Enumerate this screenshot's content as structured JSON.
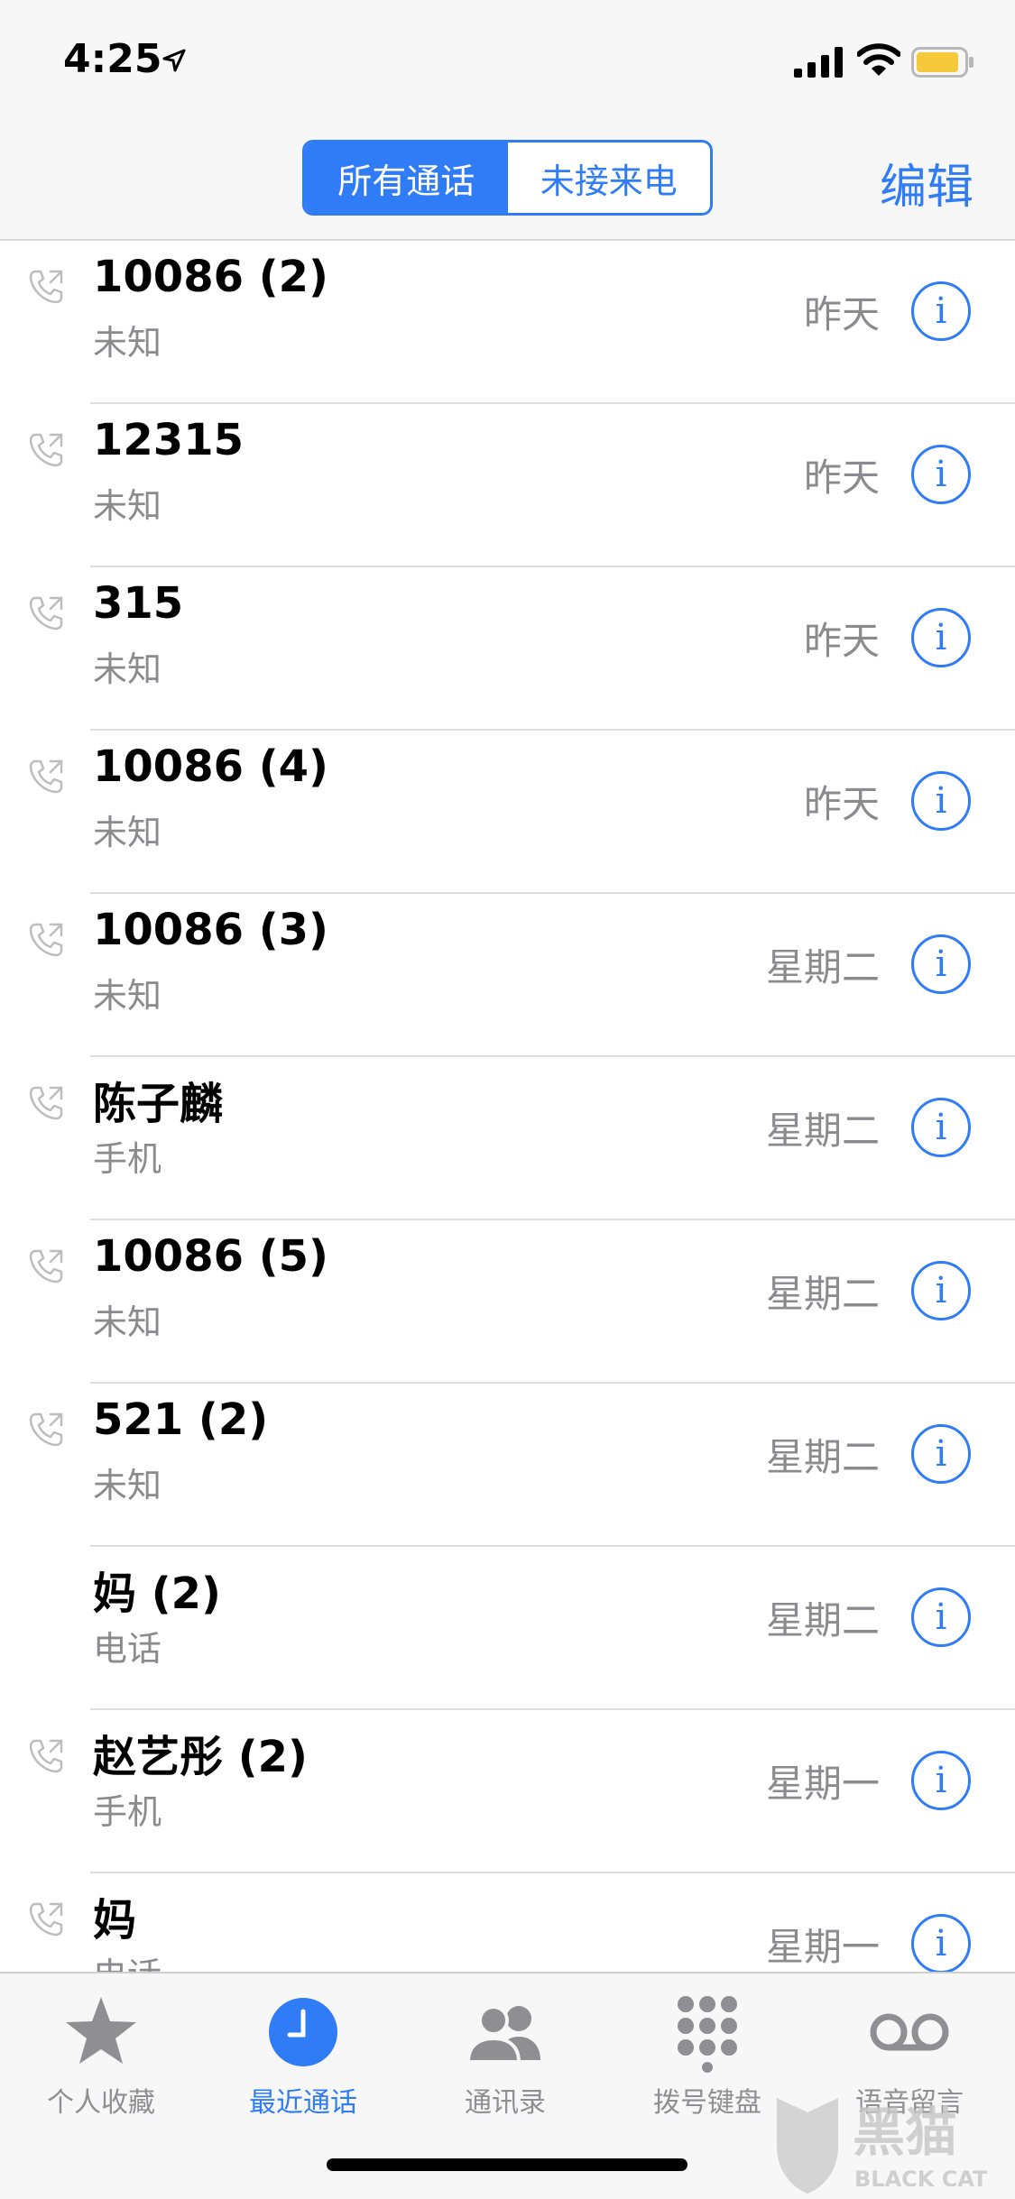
{
  "status_bar": {
    "time": "4:25"
  },
  "nav": {
    "segments": [
      "所有通话",
      "未接来电"
    ],
    "selected_segment": "所有通话",
    "edit_label": "编辑"
  },
  "calls": [
    {
      "name": "10086 (2)",
      "type": "未知",
      "date": "昨天",
      "outgoing_icon": true
    },
    {
      "name": "12315",
      "type": "未知",
      "date": "昨天",
      "outgoing_icon": true
    },
    {
      "name": "315",
      "type": "未知",
      "date": "昨天",
      "outgoing_icon": true
    },
    {
      "name": "10086 (4)",
      "type": "未知",
      "date": "昨天",
      "outgoing_icon": true
    },
    {
      "name": "10086 (3)",
      "type": "未知",
      "date": "星期二",
      "outgoing_icon": true
    },
    {
      "name": "陈子麟",
      "type": "手机",
      "date": "星期二",
      "outgoing_icon": true
    },
    {
      "name": "10086 (5)",
      "type": "未知",
      "date": "星期二",
      "outgoing_icon": true
    },
    {
      "name": "521 (2)",
      "type": "未知",
      "date": "星期二",
      "outgoing_icon": true
    },
    {
      "name": "妈 (2)",
      "type": "电话",
      "date": "星期二",
      "outgoing_icon": false
    },
    {
      "name": "赵艺彤 (2)",
      "type": "手机",
      "date": "星期一",
      "outgoing_icon": true
    },
    {
      "name": "妈",
      "type": "电话",
      "date": "星期一",
      "outgoing_icon": true
    }
  ],
  "info_glyph": "i",
  "tabs": [
    {
      "label": "个人收藏",
      "icon": "star-icon"
    },
    {
      "label": "最近通话",
      "icon": "clock-icon",
      "active": true
    },
    {
      "label": "通讯录",
      "icon": "contacts-icon"
    },
    {
      "label": "拨号键盘",
      "icon": "keypad-icon"
    },
    {
      "label": "语音留言",
      "icon": "voicemail-icon"
    }
  ],
  "watermark": {
    "text": "黑猫",
    "subtext": "BLACK CAT"
  },
  "colors": {
    "accent": "#2f7cf6",
    "secondary_text": "#8a8a8f",
    "battery": "#f5c93b"
  }
}
